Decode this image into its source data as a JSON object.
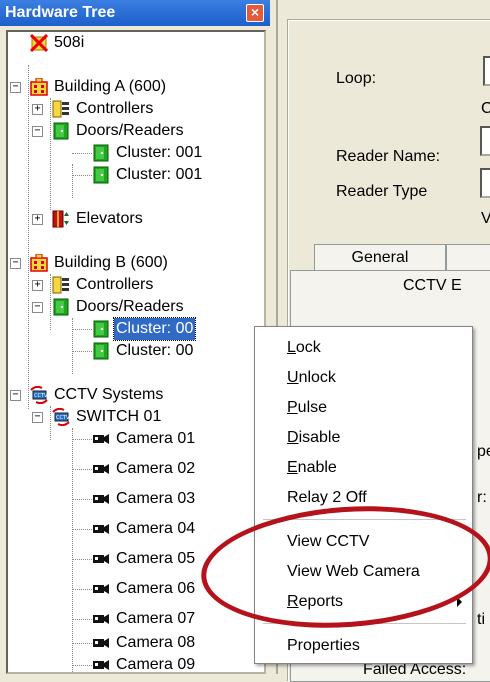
{
  "tree": {
    "title": "Hardware Tree",
    "close_glyph": "×",
    "nodes": [
      {
        "label": "508i",
        "icon": "controller-error-icon"
      },
      {
        "label": "Building A (600)",
        "icon": "building-icon"
      },
      {
        "label": "Controllers",
        "icon": "controllers-icon"
      },
      {
        "label": "Doors/Readers",
        "icon": "door-icon"
      },
      {
        "label": "Cluster: 001",
        "icon": "door-icon"
      },
      {
        "label": "Cluster: 001",
        "icon": "door-icon"
      },
      {
        "label": "Elevators",
        "icon": "elevator-icon"
      },
      {
        "label": "Building B (600)",
        "icon": "building-icon"
      },
      {
        "label": "Controllers",
        "icon": "controllers-icon"
      },
      {
        "label": "Doors/Readers",
        "icon": "door-icon"
      },
      {
        "label": "Cluster: 00",
        "icon": "door-icon",
        "selected": true
      },
      {
        "label": "Cluster: 00",
        "icon": "door-icon"
      },
      {
        "label": "CCTV Systems",
        "icon": "cctv-system-icon"
      },
      {
        "label": "SWITCH 01",
        "icon": "cctv-switch-icon"
      },
      {
        "label": "Camera 01",
        "icon": "camera-icon"
      },
      {
        "label": "Camera 02",
        "icon": "camera-icon"
      },
      {
        "label": "Camera 03",
        "icon": "camera-icon"
      },
      {
        "label": "Camera 04",
        "icon": "camera-icon"
      },
      {
        "label": "Camera 05",
        "icon": "camera-icon"
      },
      {
        "label": "Camera 06",
        "icon": "camera-icon"
      },
      {
        "label": "Camera 07",
        "icon": "camera-icon"
      },
      {
        "label": "Camera 08",
        "icon": "camera-icon"
      },
      {
        "label": "Camera 09",
        "icon": "camera-icon"
      }
    ]
  },
  "detail": {
    "loop_label": "Loop:",
    "reader_name_label": "Reader Name:",
    "reader_type_label": "Reader Type",
    "fragment_c": "C",
    "fragment_v": "V",
    "tab_general": "General",
    "tab_content_heading": "CCTV E",
    "fragment_pe": "pe",
    "fragment_r": "r:",
    "fragment_ti": "ti",
    "fragment_bottom": "Failed Access:"
  },
  "context_menu": {
    "items": [
      {
        "before": "",
        "acc": "L",
        "after": "ock"
      },
      {
        "before": "",
        "acc": "U",
        "after": "nlock"
      },
      {
        "before": "",
        "acc": "P",
        "after": "ulse"
      },
      {
        "before": "",
        "acc": "D",
        "after": "isable"
      },
      {
        "before": "",
        "acc": "E",
        "after": "nable"
      },
      {
        "before": "",
        "acc": "",
        "after": "Relay 2 Off"
      },
      {
        "before": "",
        "acc": "",
        "after": "View CCTV"
      },
      {
        "before": "",
        "acc": "",
        "after": "View Web Camera"
      },
      {
        "before": "",
        "acc": "R",
        "after": "eports"
      },
      {
        "before": "",
        "acc": "",
        "after": "Properties"
      }
    ]
  },
  "colors": {
    "selection": "#316ac5",
    "annotation": "#b5121b",
    "titlebar": "#1d5fcc"
  }
}
